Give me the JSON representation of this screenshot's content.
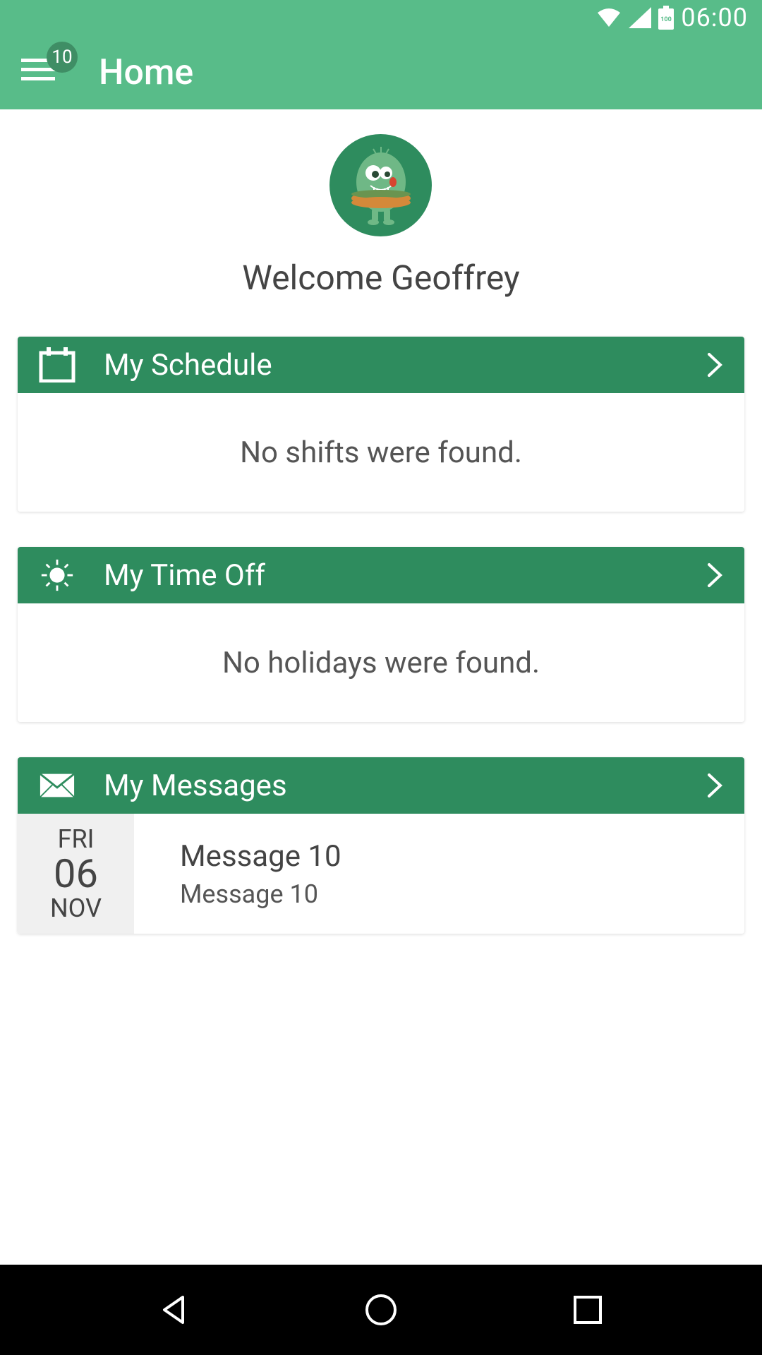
{
  "statusBar": {
    "time": "06:00"
  },
  "appBar": {
    "title": "Home",
    "badgeCount": "10"
  },
  "welcome": {
    "text": "Welcome Geoffrey"
  },
  "cards": {
    "schedule": {
      "title": "My Schedule",
      "emptyText": "No shifts were found."
    },
    "timeOff": {
      "title": "My Time Off",
      "emptyText": "No holidays were found."
    },
    "messages": {
      "title": "My Messages",
      "item": {
        "dayOfWeek": "FRI",
        "dayNum": "06",
        "month": "NOV",
        "title": "Message 10",
        "subtitle": "Message 10"
      }
    }
  }
}
